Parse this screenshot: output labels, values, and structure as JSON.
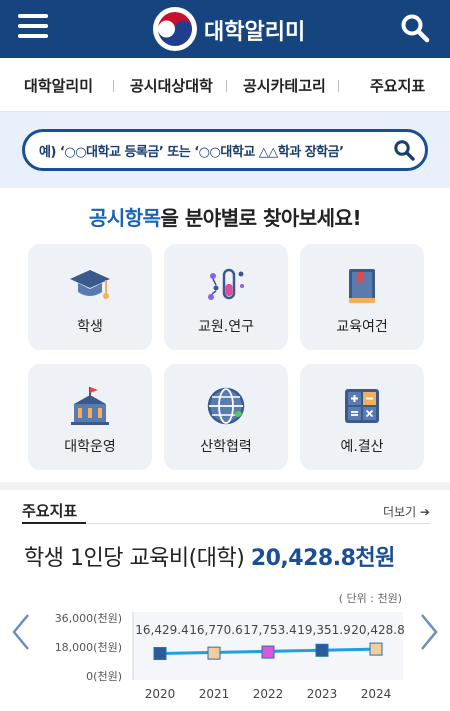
{
  "header": {
    "brand": "대학알리미",
    "colors": {
      "bar": "#16447f"
    }
  },
  "nav": {
    "items": [
      "대학알리미",
      "공시대상대학",
      "공시카테고리",
      "주요지표"
    ]
  },
  "search": {
    "placeholder": "예) ‘○○대학교 등록금’ 또는 ‘○○대학교 △△학과 장학금’"
  },
  "categories": {
    "title_accent": "공시항목",
    "title_rest": "을 분야별로 찾아보세요!",
    "tiles": [
      {
        "label": "학생",
        "icon": "graduation-cap-icon"
      },
      {
        "label": "교원.연구",
        "icon": "test-tube-icon"
      },
      {
        "label": "교육여건",
        "icon": "book-icon"
      },
      {
        "label": "대학운영",
        "icon": "university-building-icon"
      },
      {
        "label": "산학협력",
        "icon": "globe-icon"
      },
      {
        "label": "예.결산",
        "icon": "calculator-icon"
      }
    ]
  },
  "indicators": {
    "heading": "주요지표",
    "more": "더보기 ➔",
    "title": "학생 1인당 교육비(대학)",
    "value": "20,428.8천원",
    "unit_note": "( 단위 : 천원)"
  },
  "chart_data": {
    "type": "line",
    "x": [
      "2020",
      "2021",
      "2022",
      "2023",
      "2024"
    ],
    "series": [
      {
        "values": [
          16429.4,
          16770.6,
          17753.4,
          19351.9,
          20428.8
        ]
      }
    ],
    "value_labels": [
      "16,429.4",
      "16,770.6",
      "17,753.4",
      "19,351.9",
      "20,428.8"
    ],
    "ytick_labels": [
      "36,000(천원)",
      "18,000(천원)",
      "0(천원)"
    ],
    "ylim": [
      0,
      36000
    ],
    "grid": false,
    "line_color": "#1f9fe0",
    "marker_colors": [
      "#2a5c96",
      "#f3ce9b",
      "#d85ad8",
      "#2a5c96",
      "#f3ce9b"
    ]
  }
}
